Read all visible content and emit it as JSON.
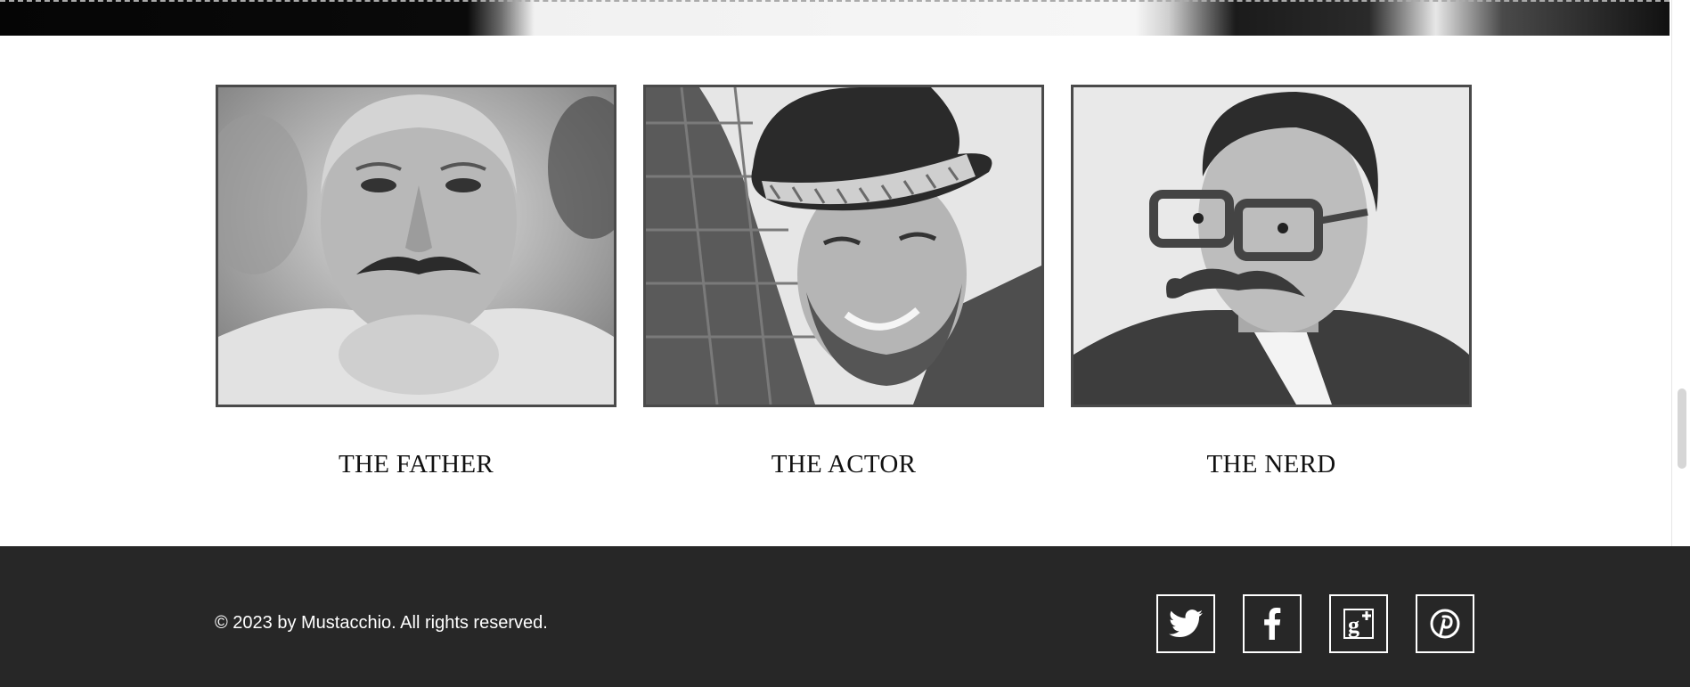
{
  "cards": [
    {
      "title": "THE FATHER",
      "image_alt": "Portrait of an older man with a mustache"
    },
    {
      "title": "THE ACTOR",
      "image_alt": "Smiling bearded man wearing a fedora"
    },
    {
      "title": "THE NERD",
      "image_alt": "Man with glasses and a curled mustache"
    }
  ],
  "footer": {
    "copyright": "© 2023 by Mustacchio. All rights reserved.",
    "social": [
      {
        "name": "twitter-icon"
      },
      {
        "name": "facebook-icon"
      },
      {
        "name": "google-plus-icon"
      },
      {
        "name": "pinterest-icon"
      }
    ]
  },
  "colors": {
    "footer_bg": "#272727",
    "photo_border": "#4a4a4a",
    "text": "#111111"
  }
}
